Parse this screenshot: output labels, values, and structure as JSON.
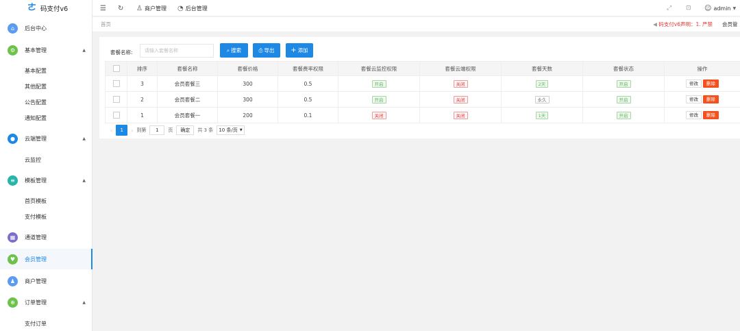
{
  "brand": {
    "name": "码支付v6"
  },
  "sidebar": {
    "items": [
      {
        "label": "后台中心",
        "icon": "home-icon",
        "color": "#5b9bf0"
      },
      {
        "label": "基本管理",
        "icon": "gear-icon",
        "color": "#6cc24a"
      },
      {
        "label": "基本配置"
      },
      {
        "label": "其他配置"
      },
      {
        "label": "公告配置"
      },
      {
        "label": "通知配置"
      },
      {
        "label": "云端管理",
        "icon": "cloud-icon",
        "color": "#1e88e5"
      },
      {
        "label": "云监控"
      },
      {
        "label": "模板管理",
        "icon": "template-icon",
        "color": "#26b5a8"
      },
      {
        "label": "首页模板"
      },
      {
        "label": "支付模板"
      },
      {
        "label": "通道管理",
        "icon": "channel-icon",
        "color": "#7c6fc8"
      },
      {
        "label": "会员管理",
        "icon": "vip-icon",
        "color": "#6cc24a"
      },
      {
        "label": "商户管理",
        "icon": "merchant-icon",
        "color": "#5b9bf0"
      },
      {
        "label": "订单管理",
        "icon": "cart-icon",
        "color": "#6cc24a"
      },
      {
        "label": "支付订单"
      }
    ]
  },
  "header": {
    "merchant_label": "商户管理",
    "backend_label": "后台管理",
    "user": "admin"
  },
  "breadcrumb": {
    "home": "首页"
  },
  "notice": {
    "text": "码支付v6声明：1. 严禁",
    "text2": "会员管"
  },
  "toolbar": {
    "search_label": "套餐名称:",
    "search_placeholder": "请输入套餐名称",
    "search_button": "搜索",
    "export_button": "导出",
    "add_button": "添加"
  },
  "table": {
    "headers": [
      "排序",
      "套餐名称",
      "套餐价格",
      "套餐费率权限",
      "套餐云监控权限",
      "套餐云端权限",
      "套餐天数",
      "套餐状态",
      "操作"
    ],
    "rows": [
      {
        "sort": "3",
        "name": "会员套餐三",
        "price": "300",
        "rate": "0.5",
        "monitor": "开启",
        "cloud": "关闭",
        "days": "2天",
        "status": "开启"
      },
      {
        "sort": "2",
        "name": "会员套餐二",
        "price": "300",
        "rate": "0.5",
        "monitor": "开启",
        "cloud": "关闭",
        "days": "永久",
        "status": "开启"
      },
      {
        "sort": "1",
        "name": "会员套餐一",
        "price": "200",
        "rate": "0.1",
        "monitor": "关闭",
        "cloud": "关闭",
        "days": "1天",
        "status": "开启"
      }
    ],
    "edit_label": "修改",
    "delete_label": "删除"
  },
  "pager": {
    "current": "1",
    "goto_label": "到第",
    "goto_value": "1",
    "page_unit": "页",
    "confirm": "确定",
    "total": "共 3 条",
    "page_size": "10 条/页"
  }
}
